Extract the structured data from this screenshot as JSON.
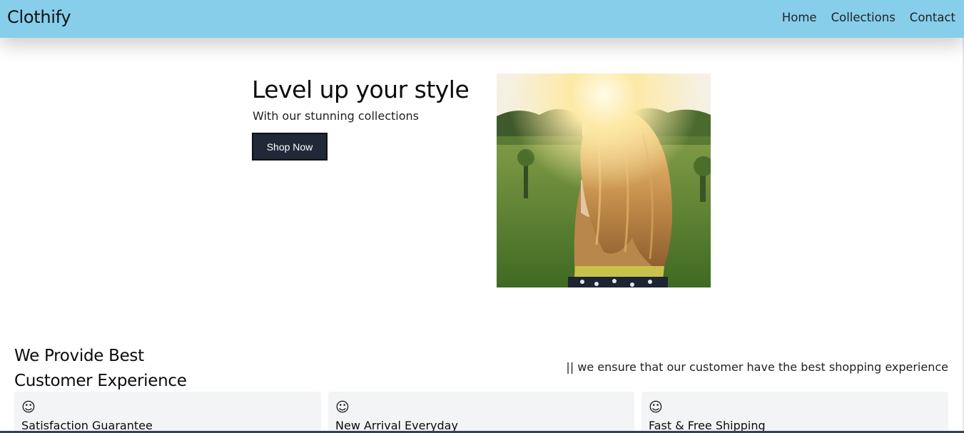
{
  "navbar": {
    "brand": "Clothify",
    "links": [
      "Home",
      "Collections",
      "Contact"
    ]
  },
  "hero": {
    "title": "Level up your style",
    "subtitle": "With our stunning collections",
    "button_label": "Shop Now"
  },
  "features": {
    "title_line1": "We Provide Best",
    "title_line2": "Customer Experience",
    "tagline": "|| we ensure that our customer have the best shopping experience",
    "cards": [
      {
        "icon": "☺",
        "title": "Satisfaction Guarantee"
      },
      {
        "icon": "☺",
        "title": "New Arrival Everyday"
      },
      {
        "icon": "☺",
        "title": "Fast & Free Shipping"
      }
    ]
  },
  "colors": {
    "navbar_bg": "#87ceeb",
    "button_bg": "#1f2937",
    "card_bg": "#f3f4f6"
  }
}
